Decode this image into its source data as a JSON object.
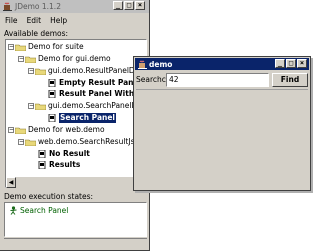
{
  "main_window": {
    "title": "JDemo 1.1.2",
    "menu": [
      "File",
      "Edit",
      "Help"
    ],
    "available_label": "Available demos:",
    "tree": [
      {
        "label": "Demo for suite",
        "type": "folder",
        "bold": false
      },
      {
        "label": "Demo for gui.demo",
        "type": "folder",
        "bold": false
      },
      {
        "label": "gui.demo.ResultPanelDemo",
        "type": "folder",
        "bold": false
      },
      {
        "label": "Empty Result Panel",
        "type": "leaf",
        "bold": true
      },
      {
        "label": "Result Panel With Re",
        "type": "leaf",
        "bold": true
      },
      {
        "label": "gui.demo.SearchPanelDemo",
        "type": "folder",
        "bold": false
      },
      {
        "label": "Search Panel",
        "type": "leaf",
        "bold": true,
        "selected": true
      },
      {
        "label": "Demo for web.demo",
        "type": "folder",
        "bold": false
      },
      {
        "label": "web.demo.SearchResultJsp",
        "type": "folder",
        "bold": false
      },
      {
        "label": "No Result",
        "type": "leaf",
        "bold": true
      },
      {
        "label": "Results",
        "type": "leaf",
        "bold": true
      }
    ],
    "states_label": "Demo execution states:",
    "states": [
      "Search Panel"
    ]
  },
  "demo_window": {
    "title": "demo",
    "search_label": "Searchc",
    "search_value": "42",
    "find_label": "Find"
  },
  "colors": {
    "selection": "#0a246a",
    "state_text": "#006000",
    "window_bg": "#d4d0c8"
  }
}
